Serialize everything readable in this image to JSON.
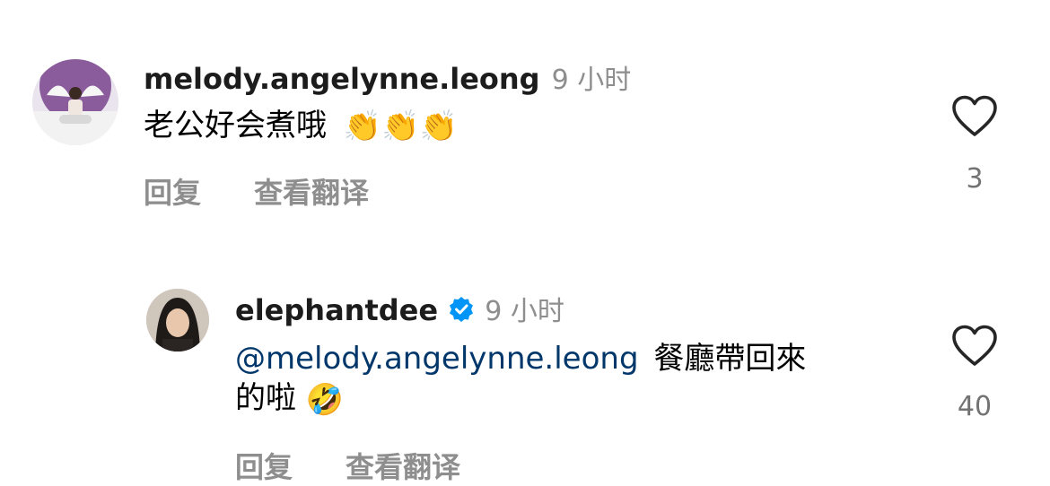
{
  "comments": [
    {
      "username": "melody.angelynne.leong",
      "time": "9 小时",
      "text": "老公好会煮哦",
      "emoji": "👏👏👏",
      "reply_label": "回复",
      "translate_label": "查看翻译",
      "like_count": "3",
      "verified": false
    },
    {
      "username": "elephantdee",
      "time": "9 小时",
      "mention": "@melody.angelynne.leong",
      "text_line1": "餐廳帶回來",
      "text_line2": "的啦",
      "emoji": "🤣",
      "reply_label": "回复",
      "translate_label": "查看翻译",
      "like_count": "40",
      "verified": true
    }
  ],
  "colors": {
    "username": "#1c1c1c",
    "secondary": "#8e8e8e",
    "mention": "#00376b",
    "verified": "#0095f6"
  }
}
